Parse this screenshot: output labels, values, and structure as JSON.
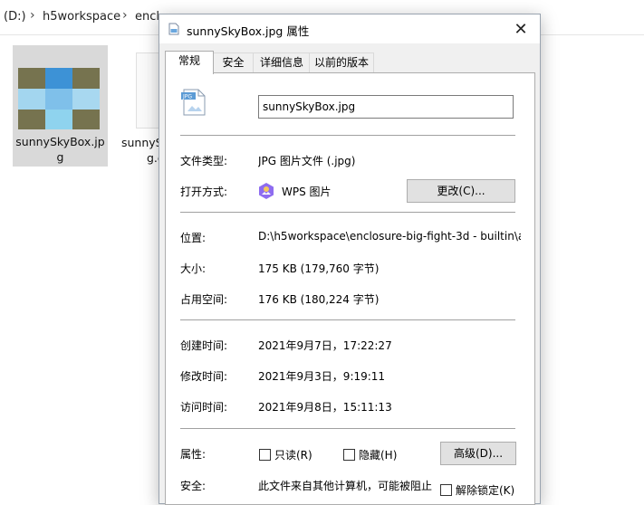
{
  "explorer": {
    "breadcrumb": [
      "(D:)",
      "h5workspace",
      "encl"
    ],
    "files": [
      {
        "name_line1": "sunnySkyBox.jp",
        "name_line2": "g"
      },
      {
        "name_line1": "sunnyS",
        "name_line2": "g.c"
      }
    ]
  },
  "dialog": {
    "title": "sunnySkyBox.jpg 属性",
    "close_label": "✕",
    "tabs": [
      "常规",
      "安全",
      "详细信息",
      "以前的版本"
    ],
    "active_tab": "常规",
    "filename": "sunnySkyBox.jpg",
    "rows": {
      "type_label": "文件类型:",
      "type_value": "JPG 图片文件 (.jpg)",
      "opens_label": "打开方式:",
      "opens_value": "WPS 图片",
      "change_button": "更改(C)...",
      "location_label": "位置:",
      "location_value": "D:\\h5workspace\\enclosure-big-fight-3d - builtin\\a",
      "size_label": "大小:",
      "size_value": "175 KB (179,760 字节)",
      "disk_label": "占用空间:",
      "disk_value": "176 KB (180,224 字节)",
      "created_label": "创建时间:",
      "created_value": "2021年9月7日，17:22:27",
      "modified_label": "修改时间:",
      "modified_value": "2021年9月3日，9:19:11",
      "accessed_label": "访问时间:",
      "accessed_value": "2021年9月8日，15:11:13",
      "attributes_label": "属性:",
      "readonly_label": "只读(R)",
      "hidden_label": "隐藏(H)",
      "advanced_button": "高级(D)...",
      "security_label": "安全:",
      "security_value": "此文件来自其他计算机，可能被阻止",
      "unblock_label": "解除锁定(K)"
    },
    "icons": {
      "title_icon": "image-file-icon",
      "file_icon": "jpg-file-icon",
      "app_icon": "wps-picture-icon"
    },
    "colors": {
      "dialog_bg": "#f0f0f0",
      "panel_bg": "#ffffff",
      "button_bg": "#e1e1e1",
      "selection_bg": "#d9d9d9"
    }
  }
}
